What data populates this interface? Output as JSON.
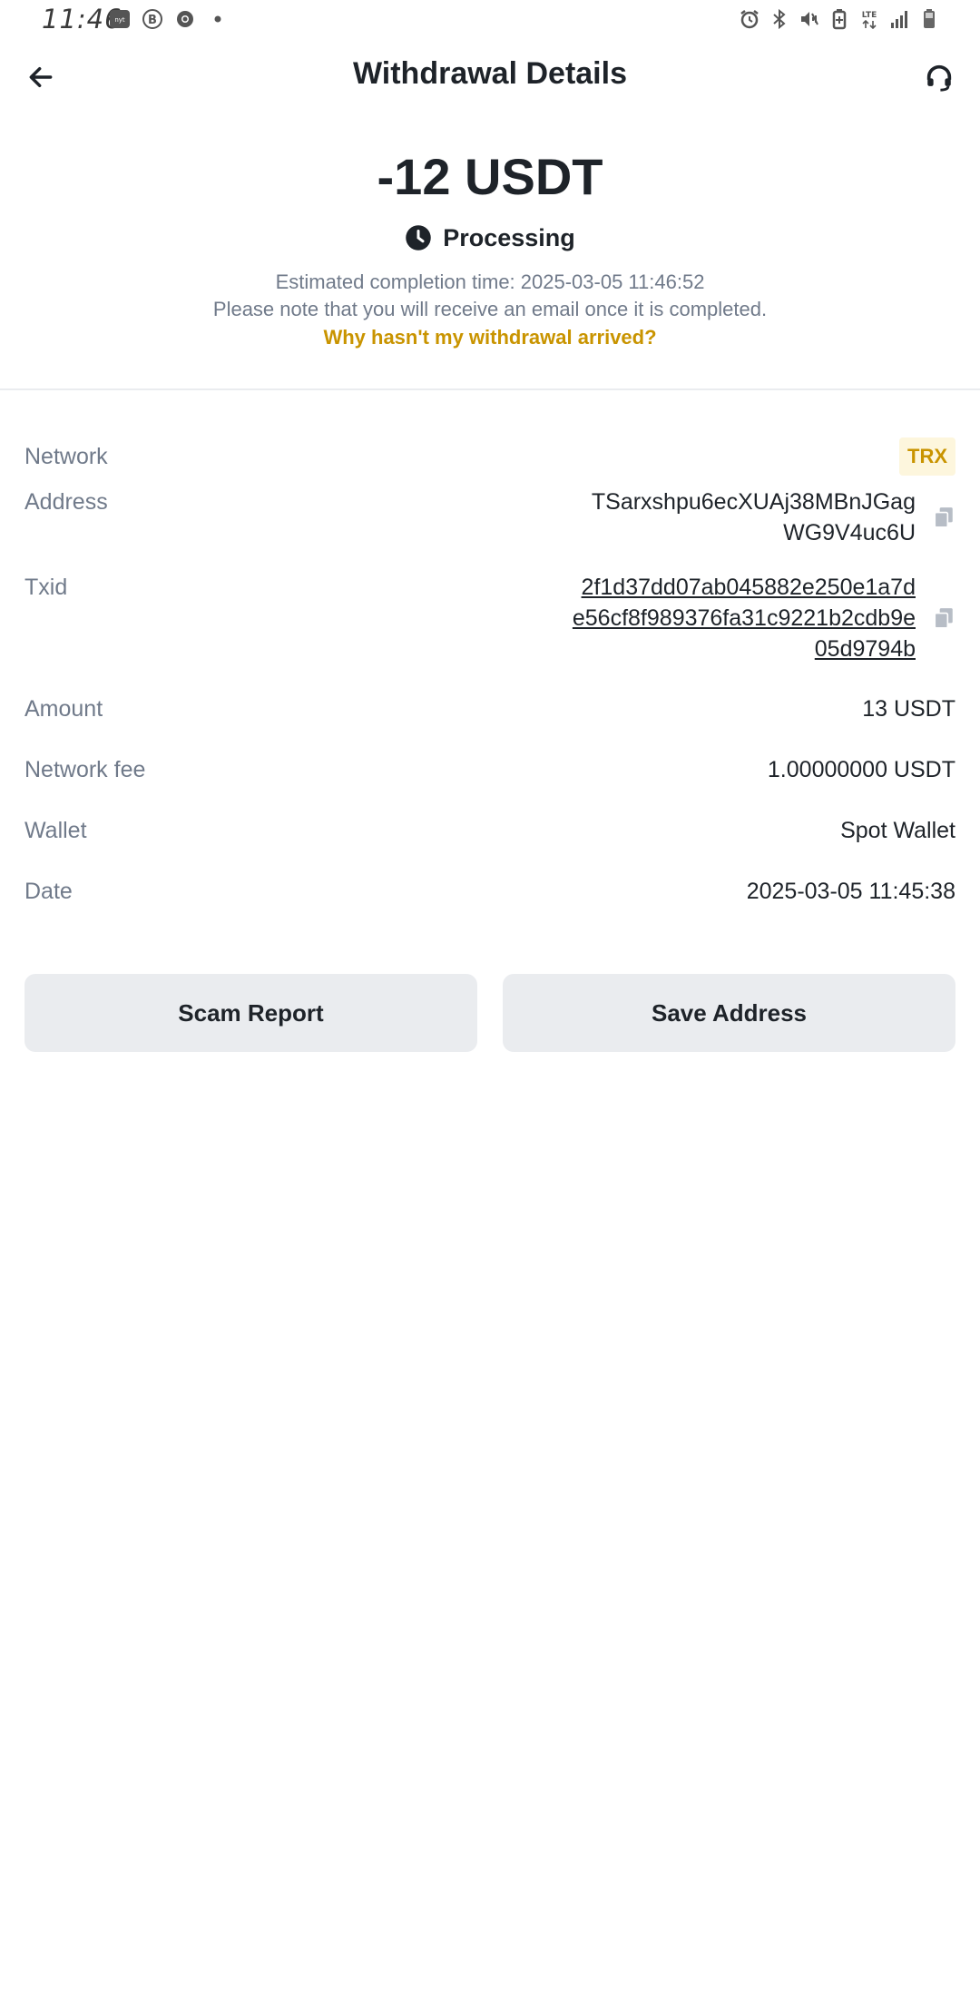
{
  "status_bar": {
    "time": "11:46",
    "left_icons": [
      "news-app-icon",
      "b-circle-icon",
      "chrome-icon",
      "dot-icon"
    ],
    "right_icons": [
      "alarm-icon",
      "bluetooth-icon",
      "mute-icon",
      "battery-saver-icon",
      "lte-icon",
      "signal-icon",
      "battery-icon"
    ],
    "network_label": "LTE"
  },
  "header": {
    "title": "Withdrawal Details",
    "back_icon": "arrow-left-icon",
    "support_icon": "headset-icon"
  },
  "summary": {
    "amount": "-12 USDT",
    "status": "Processing",
    "status_icon": "clock-icon",
    "estimated": "Estimated completion time: 2025-03-05 11:46:52",
    "note": "Please note that you will receive an email once it is completed.",
    "help_link": "Why hasn't my withdrawal arrived?"
  },
  "details": {
    "network_label": "Network",
    "network_value": "TRX",
    "address_label": "Address",
    "address_value": "TSarxshpu6ecXUAj38MBnJGagWG9V4uc6U",
    "txid_label": "Txid",
    "txid_value": "2f1d37dd07ab045882e250e1a7de56cf8f989376fa31c9221b2cdb9e05d9794b",
    "amount_label": "Amount",
    "amount_value": "13 USDT",
    "fee_label": "Network fee",
    "fee_value": "1.00000000 USDT",
    "wallet_label": "Wallet",
    "wallet_value": "Spot Wallet",
    "date_label": "Date",
    "date_value": "2025-03-05 11:45:38"
  },
  "actions": {
    "scam_report": "Scam Report",
    "save_address": "Save Address"
  },
  "colors": {
    "accent": "#c99400",
    "badge_bg": "#fdf6dd",
    "text_primary": "#1e2329",
    "text_secondary": "#707a8a",
    "button_bg": "#eaecef"
  }
}
